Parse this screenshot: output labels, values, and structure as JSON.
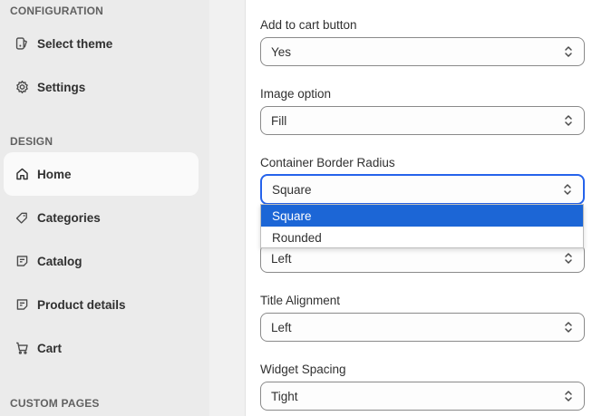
{
  "sidebar": {
    "sections": {
      "configuration": "CONFIGURATION",
      "design": "DESIGN",
      "custom_pages": "CUSTOM PAGES"
    },
    "items": [
      {
        "label": "Select theme",
        "icon": "theme-icon"
      },
      {
        "label": "Settings",
        "icon": "gear-icon"
      },
      {
        "label": "Home",
        "icon": "home-icon",
        "active": true
      },
      {
        "label": "Categories",
        "icon": "tag-icon"
      },
      {
        "label": "Catalog",
        "icon": "note-icon"
      },
      {
        "label": "Product details",
        "icon": "note-icon"
      },
      {
        "label": "Cart",
        "icon": "cart-icon"
      }
    ]
  },
  "form": {
    "fields": [
      {
        "label": "Add to cart button",
        "value": "Yes"
      },
      {
        "label": "Image option",
        "value": "Fill"
      },
      {
        "label": "Container Border Radius",
        "value": "Square"
      },
      {
        "label": "",
        "value": "Left"
      },
      {
        "label": "Title Alignment",
        "value": "Left"
      },
      {
        "label": "Widget Spacing",
        "value": "Tight"
      }
    ],
    "dropdown_options": [
      "Square",
      "Rounded"
    ],
    "dropdown_selected": "Square"
  },
  "colors": {
    "sidebar_bg": "#ebebeb",
    "active_item_bg": "#fafafa",
    "focus_border": "#2563eb",
    "option_highlight": "#1c66d6"
  }
}
